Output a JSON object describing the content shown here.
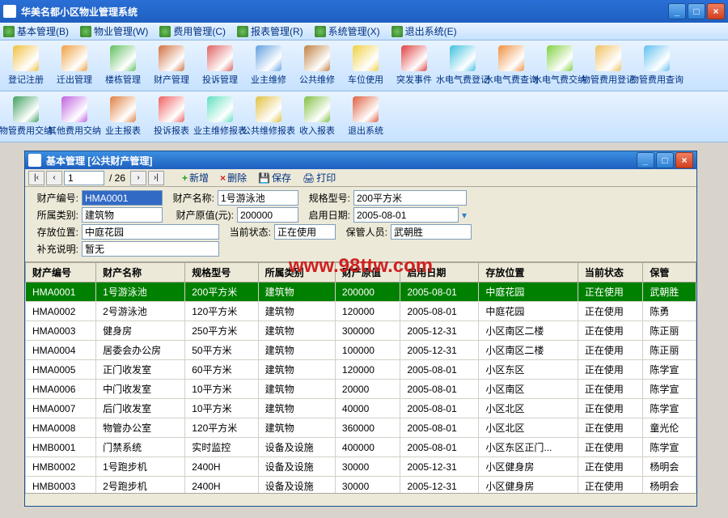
{
  "app": {
    "title": "华美名都小区物业管理系统"
  },
  "menus": [
    "基本管理(B)",
    "物业管理(W)",
    "费用管理(C)",
    "报表管理(R)",
    "系统管理(X)",
    "退出系统(E)"
  ],
  "tools_row1": [
    "登记注册",
    "迁出管理",
    "楼栋管理",
    "财产管理",
    "投诉管理",
    "业主维修",
    "公共维修",
    "车位使用",
    "突发事件",
    "水电气费登记",
    "水电气费查询",
    "水电气费交纳",
    "物管费用登记",
    "物管费用查询"
  ],
  "tools_row2": [
    "物管费用交纳",
    "其他费用交纳",
    "业主报表",
    "投诉报表",
    "业主维修报表",
    "公共维修报表",
    "收入报表",
    "退出系统"
  ],
  "tool_colors": [
    "#f0c040",
    "#f0a040",
    "#60c060",
    "#d07040",
    "#e06060",
    "#60a0e0",
    "#c08040",
    "#f0d040",
    "#e04040",
    "#40c0e0",
    "#f09040",
    "#80d040",
    "#f0c060",
    "#60c0f0",
    "#40a060",
    "#c060e0",
    "#e08040",
    "#f06060",
    "#60e0c0",
    "#e0c040",
    "#80c040",
    "#e06040"
  ],
  "childwin": {
    "title": "基本管理 [公共财产管理]"
  },
  "paginator": {
    "page": "1",
    "of": "/ 26"
  },
  "actions": {
    "add": "新增",
    "del": "删除",
    "save": "保存",
    "print": "打印"
  },
  "form": {
    "labels": {
      "code": "财产编号:",
      "name": "财产名称:",
      "spec": "规格型号:",
      "cat": "所属类别:",
      "orig": "财产原值(元):",
      "usedate": "启用日期:",
      "loc": "存放位置:",
      "status": "当前状态:",
      "keeper": "保管人员:",
      "remark": "补充说明:"
    },
    "values": {
      "code": "HMA0001",
      "name": "1号游泳池",
      "spec": "200平方米",
      "cat": "建筑物",
      "orig": "200000",
      "usedate": "2005-08-01",
      "loc": "中庭花园",
      "status": "正在使用",
      "keeper": "武朝胜",
      "remark": "暂无"
    }
  },
  "grid": {
    "headers": [
      "财产编号",
      "财产名称",
      "规格型号",
      "所属类别",
      "财产原值",
      "启用日期",
      "存放位置",
      "当前状态",
      "保管"
    ],
    "rows": [
      [
        "HMA0001",
        "1号游泳池",
        "200平方米",
        "建筑物",
        "200000",
        "2005-08-01",
        "中庭花园",
        "正在使用",
        "武朝胜"
      ],
      [
        "HMA0002",
        "2号游泳池",
        "120平方米",
        "建筑物",
        "120000",
        "2005-08-01",
        "中庭花园",
        "正在使用",
        "陈勇"
      ],
      [
        "HMA0003",
        "健身房",
        "250平方米",
        "建筑物",
        "300000",
        "2005-12-31",
        "小区南区二楼",
        "正在使用",
        "陈正丽"
      ],
      [
        "HMA0004",
        "居委会办公房",
        "50平方米",
        "建筑物",
        "100000",
        "2005-12-31",
        "小区南区二楼",
        "正在使用",
        "陈正丽"
      ],
      [
        "HMA0005",
        "正门收发室",
        "60平方米",
        "建筑物",
        "120000",
        "2005-08-01",
        "小区东区",
        "正在使用",
        "陈学宣"
      ],
      [
        "HMA0006",
        "中门收发室",
        "10平方米",
        "建筑物",
        "20000",
        "2005-08-01",
        "小区南区",
        "正在使用",
        "陈学宣"
      ],
      [
        "HMA0007",
        "后门收发室",
        "10平方米",
        "建筑物",
        "40000",
        "2005-08-01",
        "小区北区",
        "正在使用",
        "陈学宣"
      ],
      [
        "HMA0008",
        "物管办公室",
        "120平方米",
        "建筑物",
        "360000",
        "2005-08-01",
        "小区北区",
        "正在使用",
        "童光伦"
      ],
      [
        "HMB0001",
        "门禁系统",
        "实时监控",
        "设备及设施",
        "400000",
        "2005-08-01",
        "小区东区正门...",
        "正在使用",
        "陈学宣"
      ],
      [
        "HMB0002",
        "1号跑步机",
        "2400H",
        "设备及设施",
        "30000",
        "2005-12-31",
        "小区健身房",
        "正在使用",
        "杨明会"
      ],
      [
        "HMB0003",
        "2号跑步机",
        "2400H",
        "设备及设施",
        "30000",
        "2005-12-31",
        "小区健身房",
        "正在使用",
        "杨明会"
      ]
    ]
  },
  "watermark": "www.98ttw.com"
}
